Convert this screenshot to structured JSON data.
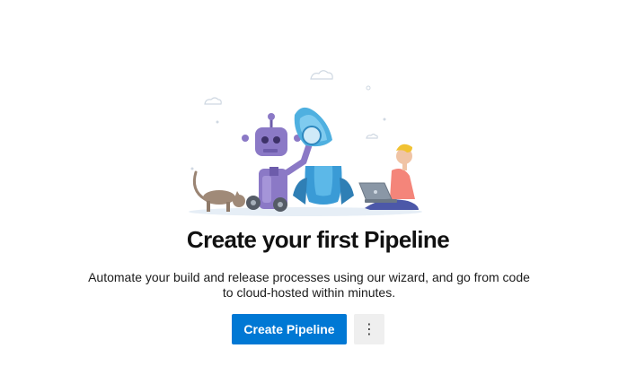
{
  "empty_state": {
    "title": "Create your first Pipeline",
    "description": "Automate your build and release processes using our wizard, and go from code to cloud-hosted within minutes.",
    "illustration_icon": "robot-rocket-developer-illustration"
  },
  "actions": {
    "create_label": "Create Pipeline",
    "more_glyph": "⋮",
    "more_icon": "more-vertical-icon",
    "primary_color": "#0078d4"
  }
}
